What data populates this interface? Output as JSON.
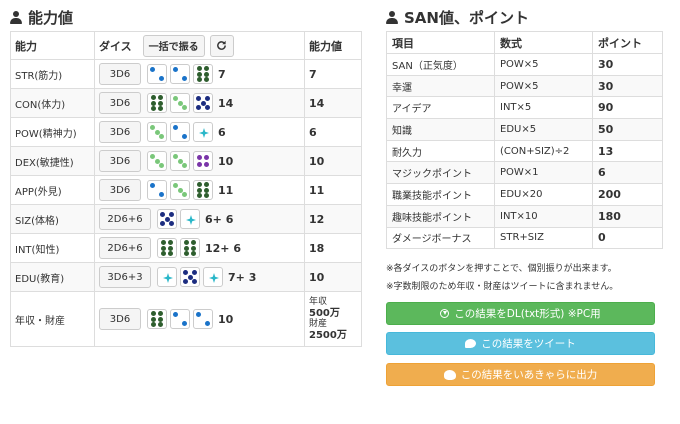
{
  "ability": {
    "title": "能力値",
    "headers": {
      "name": "能力",
      "dice": "ダイス",
      "roll_all": "一括で振る",
      "value": "能力値"
    },
    "rows": [
      {
        "name": "STR(筋力)",
        "dice": "3D6",
        "dice_values": [
          2,
          2,
          6
        ],
        "result": "7",
        "value": "7"
      },
      {
        "name": "CON(体力)",
        "dice": "3D6",
        "dice_values": [
          6,
          3,
          5
        ],
        "result": "14",
        "value": "14"
      },
      {
        "name": "POW(精神力)",
        "dice": "3D6",
        "dice_values": [
          3,
          2,
          1
        ],
        "result": "6",
        "value": "6"
      },
      {
        "name": "DEX(敏捷性)",
        "dice": "3D6",
        "dice_values": [
          3,
          3,
          4
        ],
        "result": "10",
        "value": "10"
      },
      {
        "name": "APP(外見)",
        "dice": "3D6",
        "dice_values": [
          2,
          3,
          6
        ],
        "result": "11",
        "value": "11"
      },
      {
        "name": "SIZ(体格)",
        "dice": "2D6+6",
        "dice_values": [
          5,
          1
        ],
        "result": "6+ 6",
        "value": "12"
      },
      {
        "name": "INT(知性)",
        "dice": "2D6+6",
        "dice_values": [
          6,
          6
        ],
        "result": "12+ 6",
        "value": "18"
      },
      {
        "name": "EDU(教育)",
        "dice": "3D6+3",
        "dice_values": [
          1,
          5,
          1
        ],
        "result": "7+ 3",
        "value": "10"
      },
      {
        "name": "年収・財産",
        "dice": "3D6",
        "dice_values": [
          6,
          2,
          2
        ],
        "result": "10",
        "value_lines": [
          "年収",
          "500万",
          "財産",
          "2500万"
        ]
      }
    ]
  },
  "san": {
    "title": "SAN値、ポイント",
    "headers": {
      "item": "項目",
      "formula": "数式",
      "point": "ポイント"
    },
    "rows": [
      {
        "item": "SAN（正気度）",
        "formula": "POW×5",
        "point": "30"
      },
      {
        "item": "幸運",
        "formula": "POW×5",
        "point": "30"
      },
      {
        "item": "アイデア",
        "formula": "INT×5",
        "point": "90"
      },
      {
        "item": "知識",
        "formula": "EDU×5",
        "point": "50"
      },
      {
        "item": "耐久力",
        "formula": "(CON+SIZ)÷2",
        "point": "13"
      },
      {
        "item": "マジックポイント",
        "formula": "POW×1",
        "point": "6"
      },
      {
        "item": "職業技能ポイント",
        "formula": "EDU×20",
        "point": "200"
      },
      {
        "item": "趣味技能ポイント",
        "formula": "INT×10",
        "point": "180"
      },
      {
        "item": "ダメージボーナス",
        "formula": "STR+SIZ",
        "point": "0"
      }
    ]
  },
  "notes": [
    "※各ダイスのボタンを押すことで、個別振りが出来ます。",
    "※字数制限のため年収・財産はツイートに含まれません。"
  ],
  "actions": {
    "download": "この結果をDL(txt形式) ※PC用",
    "tweet": "この結果をツイート",
    "iachara": "この結果をいあきゃらに出力"
  },
  "colors": {
    "die_1": "#2ab7c9",
    "die_2": "#1a73c9",
    "die_3": "#7ac77a",
    "die_4": "#7a35a8",
    "die_5": "#1c2d80",
    "die_6": "#2e5e2e",
    "btn_green": "#5cb85c",
    "btn_blue": "#5bc0de",
    "btn_orange": "#f0ad4e"
  }
}
